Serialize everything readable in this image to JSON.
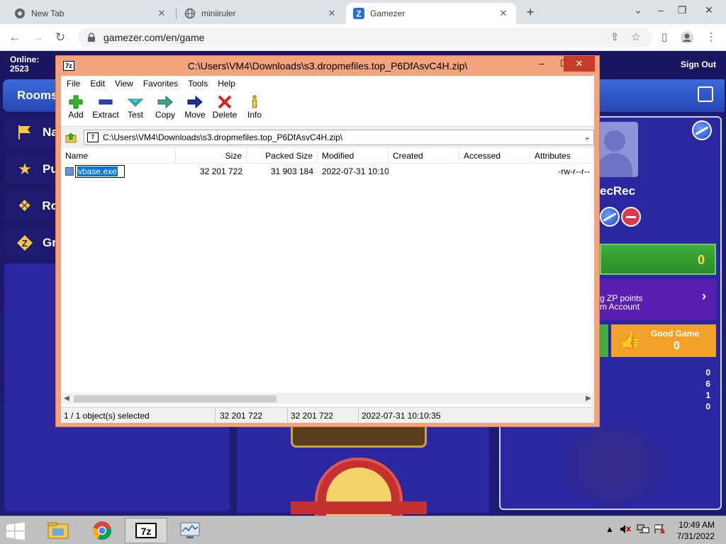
{
  "browser": {
    "tabs": [
      {
        "title": "New Tab"
      },
      {
        "title": "miniiruler"
      },
      {
        "title": "Gamezer"
      }
    ],
    "url": "gamezer.com/en/game"
  },
  "page": {
    "online_label": "Online:",
    "online_count": "2523",
    "sign_out": "Sign Out",
    "rooms": "Rooms",
    "menu": [
      "Na",
      "Pu",
      "Ro",
      "Gr"
    ],
    "user_name": "ecRec",
    "green_value": "0",
    "zp_line1": "g ZP points",
    "zp_line2": "m Account",
    "good_game_label": "Good Game",
    "good_game_value": "0",
    "stats": [
      "0",
      "6",
      "1",
      "0"
    ]
  },
  "zip": {
    "title": "C:\\Users\\VM4\\Downloads\\s3.dropmefiles.top_P6DfAsvC4H.zip\\",
    "menu": [
      "File",
      "Edit",
      "View",
      "Favorites",
      "Tools",
      "Help"
    ],
    "tools": {
      "add": "Add",
      "extract": "Extract",
      "test": "Test",
      "copy": "Copy",
      "move": "Move",
      "delete": "Delete",
      "info": "Info"
    },
    "path": "C:\\Users\\VM4\\Downloads\\s3.dropmefiles.top_P6DfAsvC4H.zip\\",
    "columns": {
      "name": "Name",
      "size": "Size",
      "packed": "Packed Size",
      "modified": "Modified",
      "created": "Created",
      "accessed": "Accessed",
      "attributes": "Attributes"
    },
    "file": {
      "name": "vbase.exe",
      "size": "32 201 722",
      "packed": "31 903 184",
      "modified": "2022-07-31 10:10",
      "attributes": "-rw-r--r--"
    },
    "status": {
      "selected": "1 / 1 object(s) selected",
      "size": "32 201 722",
      "packed": "32 201 722",
      "modified": "2022-07-31 10:10:35"
    }
  },
  "taskbar": {
    "time": "10:49 AM",
    "date": "7/31/2022"
  },
  "colors": {
    "zip_frame": "#f4a47d",
    "page_bg": "#211c77",
    "accent_blue": "#2447b5"
  }
}
